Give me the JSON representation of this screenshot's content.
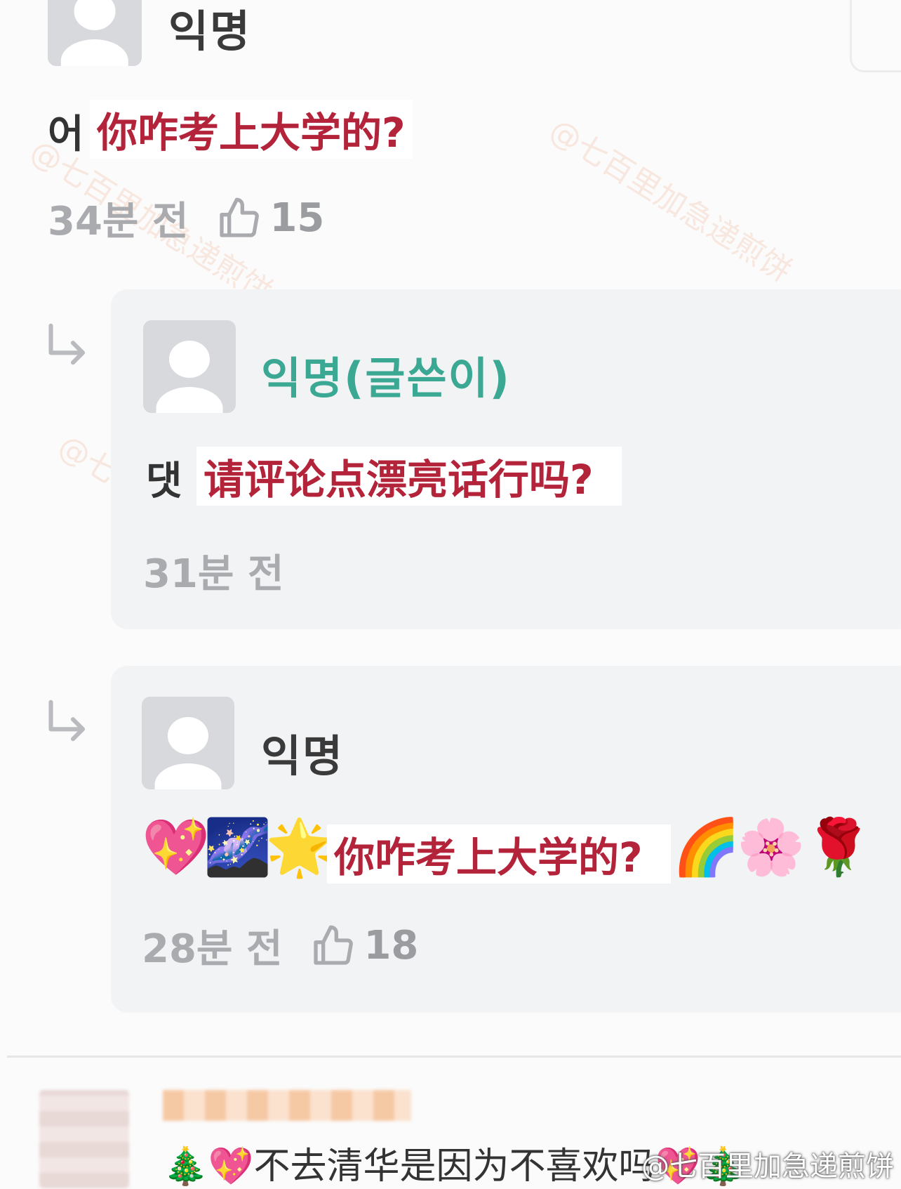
{
  "comment": {
    "author": "익명",
    "text_prefix": "어",
    "text_overlay": "你咋考上大学的?",
    "time": "34분 전",
    "likes": "15"
  },
  "replies": [
    {
      "author": "익명(글쓴이)",
      "text_prefix": "댓",
      "text_overlay": "请评论点漂亮话行吗?",
      "time": "31분 전"
    },
    {
      "author": "익명",
      "emoji_before": [
        "💖",
        "🌌",
        "🌟"
      ],
      "text_overlay": "你咋考上大学的?",
      "emoji_after": [
        "🌈",
        "🌸",
        "🌹"
      ],
      "time": "28분 전",
      "likes": "18"
    }
  ],
  "bottom_comment": {
    "text": "🎄💖不去清华是因为不喜欢吗💖🎄"
  },
  "watermark": "@七百里加急递煎饼",
  "icons": {
    "like": "thumbs-up-icon",
    "reply": "reply-arrow-icon"
  },
  "colors": {
    "overlay_text": "#b3233a",
    "author_highlight": "#3aa893",
    "meta": "#a9abae"
  }
}
